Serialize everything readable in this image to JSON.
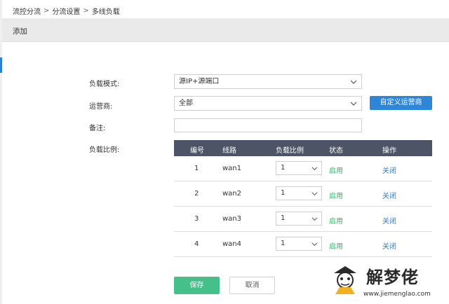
{
  "breadcrumb": {
    "item1": "流控分流",
    "item2": "分流设置",
    "item3": "多线负载",
    "sep": ">"
  },
  "page_title": "添加",
  "form": {
    "load_mode": {
      "label": "负载模式:",
      "value": "源IP+源端口"
    },
    "isp": {
      "label": "运营商:",
      "value": "全部",
      "custom_button": "自定义运营商"
    },
    "note": {
      "label": "备注:",
      "value": ""
    },
    "ratio_label": "负载比例:"
  },
  "table": {
    "headers": {
      "num": "编号",
      "line": "线路",
      "ratio": "负载比例",
      "status": "状态",
      "op": "操作"
    },
    "rows": [
      {
        "num": "1",
        "line": "wan1",
        "ratio": "1",
        "status": "启用",
        "op": "关闭"
      },
      {
        "num": "2",
        "line": "wan2",
        "ratio": "1",
        "status": "启用",
        "op": "关闭"
      },
      {
        "num": "3",
        "line": "wan3",
        "ratio": "1",
        "status": "启用",
        "op": "关闭"
      },
      {
        "num": "4",
        "line": "wan4",
        "ratio": "1",
        "status": "启用",
        "op": "关闭"
      }
    ]
  },
  "buttons": {
    "save": "保存",
    "cancel": "取消"
  },
  "watermark": {
    "title": "解梦佬",
    "url": "www.jiemenglao.com"
  },
  "colors": {
    "accent_blue": "#2f86d6",
    "save_green": "#45c08a",
    "status_green": "#3bb06f",
    "table_header": "#4c5466"
  }
}
